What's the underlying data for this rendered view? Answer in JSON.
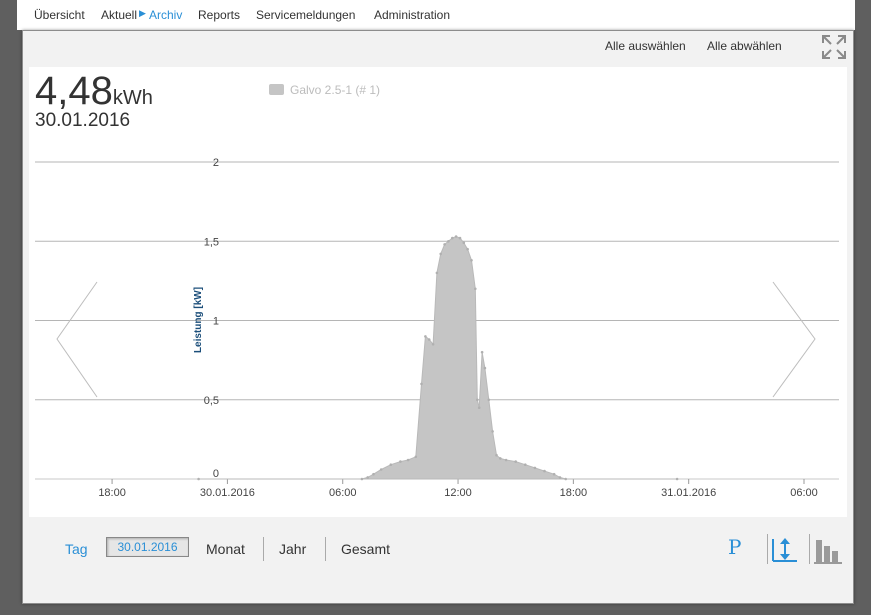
{
  "nav": {
    "items": [
      {
        "label": "Übersicht"
      },
      {
        "label": "Aktuell"
      },
      {
        "label": "Archiv"
      },
      {
        "label": "Reports"
      },
      {
        "label": "Servicemeldungen"
      },
      {
        "label": "Administration"
      }
    ],
    "active": "Archiv"
  },
  "toolbar": {
    "select_all": "Alle auswählen",
    "deselect_all": "Alle abwählen",
    "fullscreen_icon": "fullscreen-icon"
  },
  "summary": {
    "value": "4,48",
    "unit": "kWh",
    "date": "30.01.2016"
  },
  "legend": {
    "label": "Galvo 2.5-1 (# 1)",
    "color": "#c5c5c5"
  },
  "chart_data": {
    "type": "area",
    "ylabel": "Leistung [kW]",
    "ylim": [
      0,
      2
    ],
    "yticks": [
      "0",
      "0,5",
      "1",
      "1,5",
      "2"
    ],
    "xtick_labels": [
      "18:00",
      "30.01.2016",
      "06:00",
      "12:00",
      "18:00",
      "31.01.2016",
      "06:00"
    ],
    "x_hours": [
      -6,
      0,
      6,
      12,
      18,
      24,
      30
    ],
    "series": [
      {
        "color": "#c5c5c5",
        "x": [
          -1.5,
          7.0,
          7.3,
          7.6,
          8.0,
          8.5,
          9.0,
          9.4,
          9.8,
          10.1,
          10.3,
          10.5,
          10.7,
          10.9,
          11.1,
          11.3,
          11.5,
          11.7,
          11.9,
          12.1,
          12.3,
          12.5,
          12.7,
          12.9,
          13.0,
          13.1,
          13.25,
          13.4,
          13.6,
          13.8,
          14.0,
          14.2,
          14.5,
          15.0,
          15.5,
          16.0,
          16.5,
          17.0,
          17.3,
          17.6,
          23.4
        ],
        "values": [
          0,
          0,
          0.01,
          0.03,
          0.06,
          0.09,
          0.11,
          0.12,
          0.14,
          0.6,
          0.9,
          0.88,
          0.85,
          1.3,
          1.42,
          1.48,
          1.5,
          1.52,
          1.53,
          1.52,
          1.49,
          1.45,
          1.38,
          1.2,
          0.5,
          0.45,
          0.8,
          0.7,
          0.5,
          0.3,
          0.15,
          0.13,
          0.12,
          0.11,
          0.09,
          0.07,
          0.05,
          0.03,
          0.01,
          0,
          0
        ]
      }
    ],
    "grid": true
  },
  "period_tabs": {
    "day": "Tag",
    "day_value": "30.01.2016",
    "month": "Monat",
    "year": "Jahr",
    "total": "Gesamt"
  },
  "tools": {
    "power_label": "P",
    "scale_icon": "vertical-scale-icon",
    "bars_icon": "bar-chart-icon"
  }
}
